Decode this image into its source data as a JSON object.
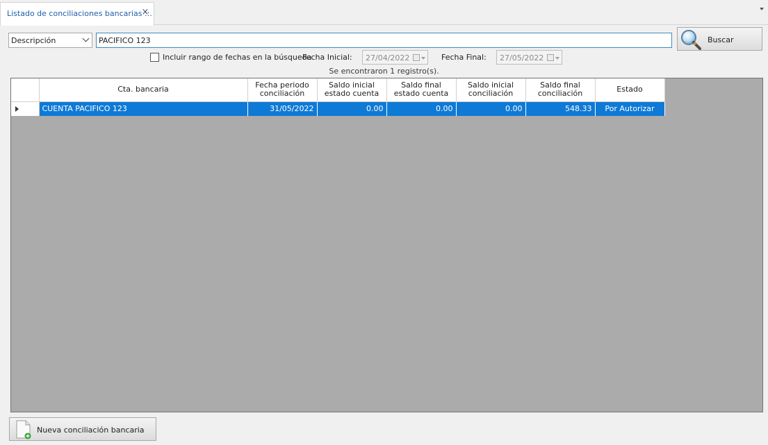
{
  "tab": {
    "title": "Listado de conciliaciones bancarias ::.",
    "close_glyph": "×"
  },
  "search": {
    "field_option": "Descripción",
    "query": "PACIFICO 123",
    "button_label": "Buscar",
    "button_icon": "magnifier-icon"
  },
  "filters": {
    "include_range_label": "Incluir rango de fechas en la búsqueda",
    "include_range_checked": false,
    "start_label": "Fecha Inicial:",
    "start_value": "27/04/2022",
    "end_label": "Fecha Final:",
    "end_value": "27/05/2022"
  },
  "status": "Se encontraron 1 registro(s).",
  "table": {
    "headers": {
      "account": "Cta. bancaria",
      "period_date": "Fecha periodo conciliación",
      "initial_stmt": "Saldo inicial estado cuenta",
      "final_stmt": "Saldo final estado cuenta",
      "initial_conc": "Saldo inicial conciliación",
      "final_conc": "Saldo final conciliación",
      "state": "Estado"
    },
    "rows": [
      {
        "account": "CUENTA PACIFICO 123",
        "period_date": "31/05/2022",
        "initial_stmt": "0.00",
        "final_stmt": "0.00",
        "initial_conc": "0.00",
        "final_conc": "548.33",
        "state": "Por Autorizar"
      }
    ]
  },
  "new_button": {
    "label": "Nueva conciliación bancaria",
    "icon": "new-document-icon"
  },
  "colors": {
    "selected_row": "#0f7ad6",
    "grid_background": "#ababab",
    "tab_text": "#1f5fa8"
  }
}
